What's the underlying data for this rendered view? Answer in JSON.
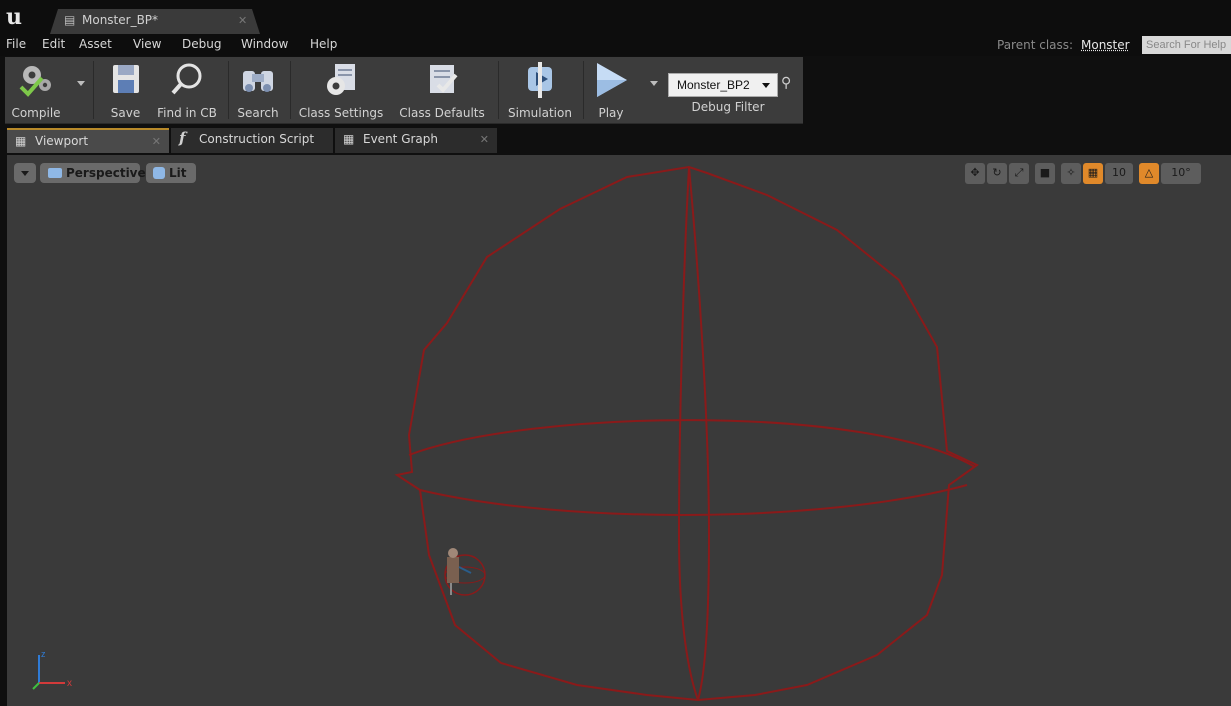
{
  "titlebar": {
    "app_logo": "u",
    "document_tab": {
      "label": "Monster_BP*",
      "icon": "blueprint-doc-icon"
    }
  },
  "menu": {
    "items": [
      "File",
      "Edit",
      "Asset",
      "View",
      "Debug",
      "Window",
      "Help"
    ],
    "parent_class_label": "Parent class:",
    "parent_class_value": "Monster",
    "help_search_placeholder": "Search For Help"
  },
  "toolbar": {
    "buttons": [
      {
        "label": "Compile",
        "icon": "compile-gear-check-icon"
      },
      {
        "label": "Save",
        "icon": "floppy-disk-icon"
      },
      {
        "label": "Find in CB",
        "icon": "magnifier-icon"
      },
      {
        "label": "Search",
        "icon": "binoculars-icon"
      },
      {
        "label": "Class Settings",
        "icon": "class-settings-gear-icon"
      },
      {
        "label": "Class Defaults",
        "icon": "class-defaults-checklist-icon"
      },
      {
        "label": "Simulation",
        "icon": "simulation-play-icon"
      },
      {
        "label": "Play",
        "icon": "play-triangle-icon"
      }
    ],
    "debug_object": "Monster_BP2",
    "debug_filter_label": "Debug Filter"
  },
  "editor_tabs": [
    {
      "label": "Viewport",
      "icon": "viewport-grid-icon",
      "active": true
    },
    {
      "label": "Construction Script",
      "icon": "function-f-icon",
      "active": false
    },
    {
      "label": "Event Graph",
      "icon": "event-graph-icon",
      "active": false
    }
  ],
  "viewport": {
    "view_mode": "Perspective",
    "lighting_mode": "Lit",
    "grid_snap_value": "10",
    "rotation_snap_value": "10°",
    "axis_labels": {
      "x": "x",
      "z": "z"
    },
    "colors": {
      "background": "#3a3a3a",
      "wireframe": "#8a1a1a",
      "active_snap": "#e0892a"
    }
  }
}
